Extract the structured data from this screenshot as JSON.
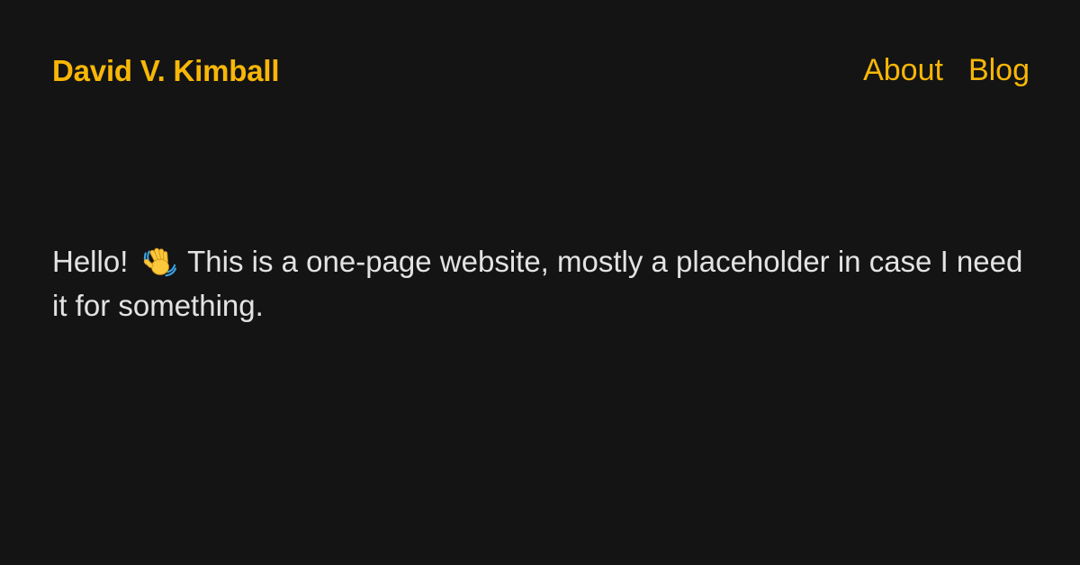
{
  "header": {
    "site_title": "David V. Kimball",
    "nav": {
      "about": "About",
      "blog": "Blog"
    }
  },
  "main": {
    "intro_before": "Hello!",
    "intro_icon": "waving-hand-icon",
    "intro_after": "This is a one-page website, mostly a placeholder in case I need it for something."
  },
  "colors": {
    "background": "#141414",
    "accent": "#f8b707",
    "text": "#e3e3e3"
  }
}
